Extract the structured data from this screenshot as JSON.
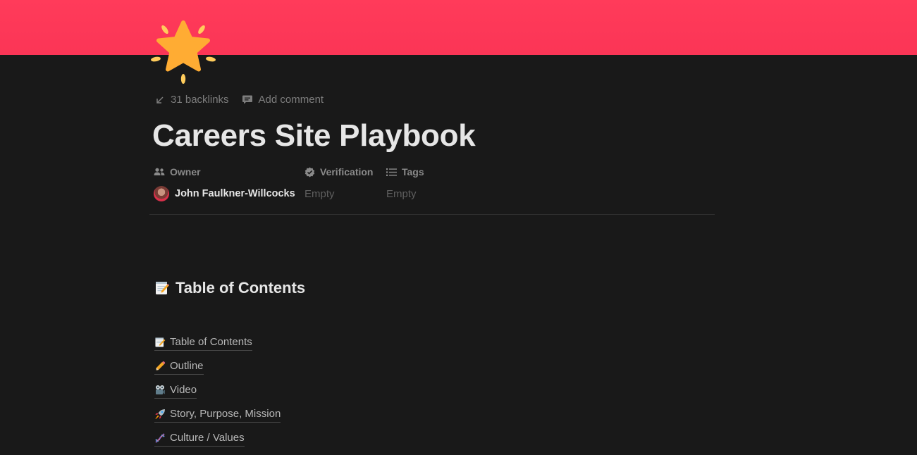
{
  "cover": {
    "color": "#ff3b5a"
  },
  "page_icon": {
    "name": "glowing-star-icon"
  },
  "meta": {
    "backlinks_label": "31 backlinks",
    "add_comment_label": "Add comment"
  },
  "title": "Careers Site Playbook",
  "properties": {
    "owner": {
      "label": "Owner",
      "value": "John Faulkner-Willcocks"
    },
    "verification": {
      "label": "Verification",
      "value": "Empty"
    },
    "tags": {
      "label": "Tags",
      "value": "Empty"
    }
  },
  "section": {
    "heading": "Table of Contents",
    "icon": "memo-icon"
  },
  "toc": [
    {
      "label": "Table of Contents",
      "icon": "memo-icon"
    },
    {
      "label": "Outline",
      "icon": "pencil-icon"
    },
    {
      "label": "Video",
      "icon": "camera-icon"
    },
    {
      "label": "Story, Purpose, Mission",
      "icon": "rocket-icon"
    },
    {
      "label": "Culture / Values",
      "icon": "dna-icon"
    }
  ]
}
